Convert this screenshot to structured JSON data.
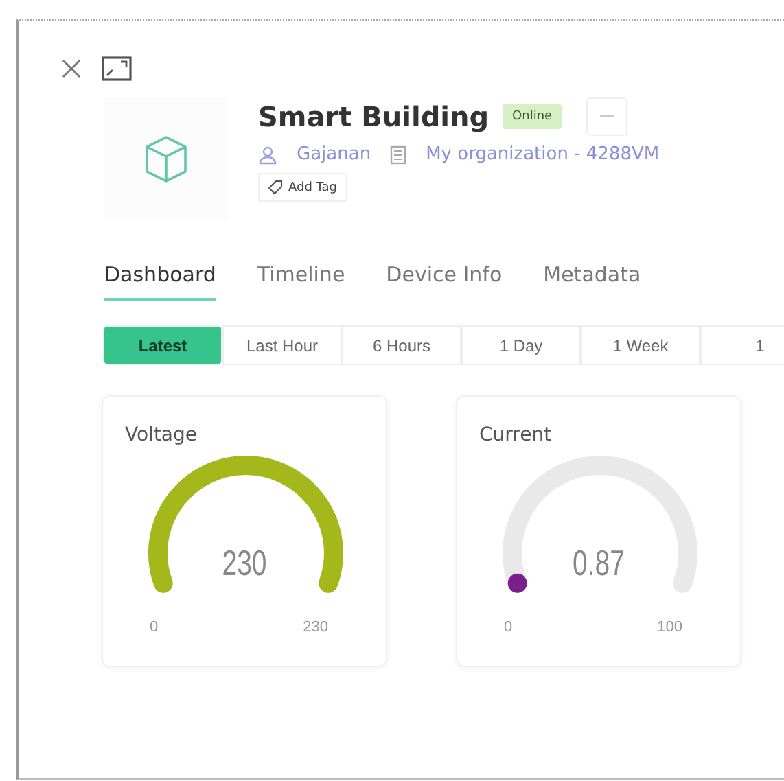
{
  "device": {
    "name": "Smart Building",
    "status": "Online",
    "owner": "Gajanan",
    "organization": "My organization - 4288VM",
    "add_tag": "Add Tag"
  },
  "tabs": [
    {
      "label": "Dashboard",
      "selected": true
    },
    {
      "label": "Timeline",
      "selected": false
    },
    {
      "label": "Device Info",
      "selected": false
    },
    {
      "label": "Metadata",
      "selected": false
    }
  ],
  "time_ranges": [
    {
      "label": "Latest",
      "selected": true
    },
    {
      "label": "Last Hour",
      "selected": false
    },
    {
      "label": "6 Hours",
      "selected": false
    },
    {
      "label": "1 Day",
      "selected": false
    },
    {
      "label": "1 Week",
      "selected": false
    },
    {
      "label": "1",
      "selected": false
    }
  ],
  "gauges": [
    {
      "title": "Voltage",
      "value": "230",
      "min": "0",
      "max": "230",
      "color": "#a4b81c"
    },
    {
      "title": "Current",
      "value": "0.87",
      "min": "0",
      "max": "100",
      "color": "#7a1f8c"
    }
  ]
}
